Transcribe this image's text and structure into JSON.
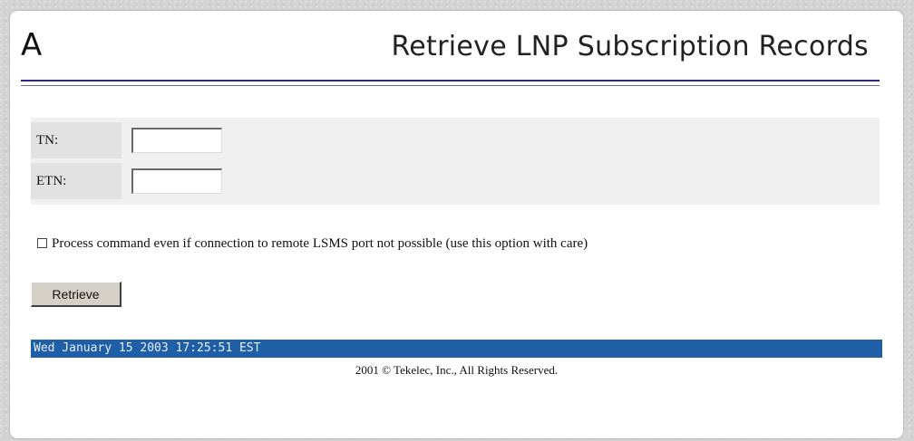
{
  "header": {
    "logo_letter": "A",
    "title": "Retrieve LNP Subscription Records"
  },
  "form": {
    "tn_label": "TN:",
    "tn_value": "",
    "etn_label": "ETN:",
    "etn_value": ""
  },
  "option": {
    "checked": false,
    "label": "Process command even if connection to remote LSMS port not possible (use this option with care)"
  },
  "actions": {
    "retrieve_label": "Retrieve"
  },
  "status": {
    "timestamp": "Wed January 15 2003 17:25:51 EST"
  },
  "footer": {
    "copyright": "2001 © Tekelec, Inc., All Rights Reserved."
  },
  "colors": {
    "status_bar": "#1e5fa8",
    "header_rule": "#2b2b7a",
    "form_background": "#f0f0f0"
  }
}
